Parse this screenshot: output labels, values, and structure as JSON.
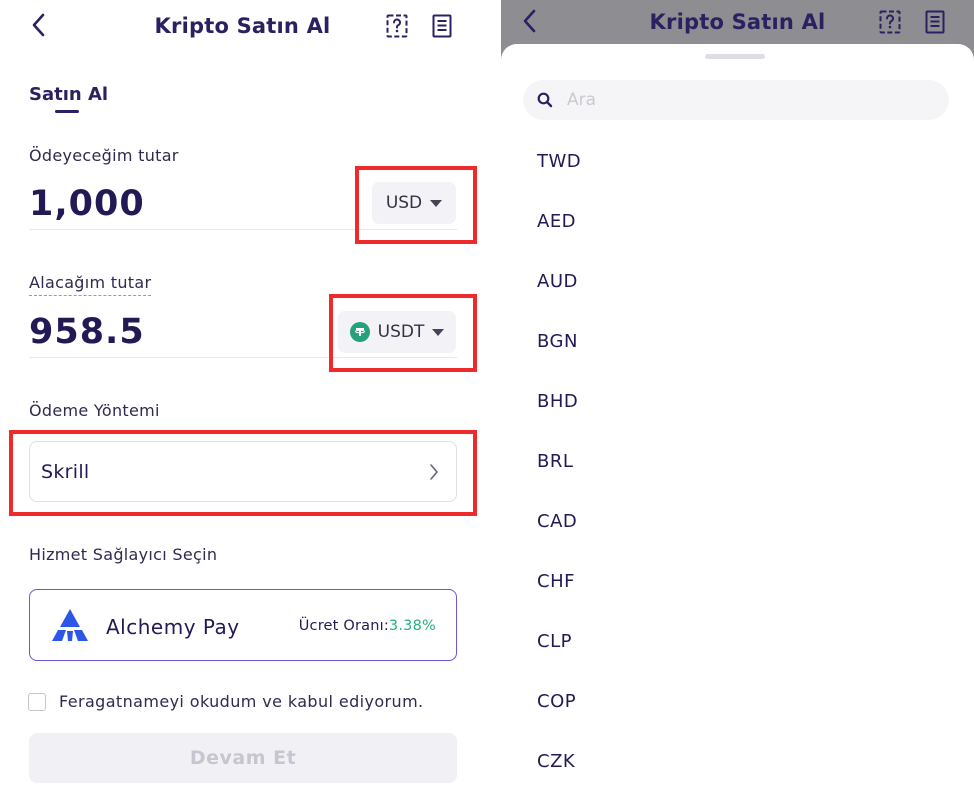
{
  "header": {
    "title": "Kripto Satın Al"
  },
  "tabs": {
    "buy": "Satın Al"
  },
  "pay": {
    "label": "Ödeyeceğim tutar",
    "amount": "1,000",
    "currency": "USD"
  },
  "receive": {
    "label": "Alacağım tutar",
    "amount": "958.5",
    "currency": "USDT"
  },
  "payment_method": {
    "label": "Ödeme Yöntemi",
    "value": "Skrill"
  },
  "provider": {
    "label": "Hizmet Sağlayıcı Seçin",
    "name": "Alchemy Pay",
    "fee_label": "Ücret Oranı:",
    "fee_rate": "3.38%"
  },
  "disclaimer": {
    "label": "Feragatnameyi okudum ve kabul ediyorum.",
    "checked": false
  },
  "continue_label": "Devam Et",
  "search": {
    "placeholder": "Ara"
  },
  "currencies": [
    "TWD",
    "AED",
    "AUD",
    "BGN",
    "BHD",
    "BRL",
    "CAD",
    "CHF",
    "CLP",
    "COP",
    "CZK"
  ],
  "colors": {
    "accent": "#2a2160",
    "highlight": "#ee2a2a",
    "provider_border": "#6c56d6",
    "fee_green": "#26b27a",
    "tether_green": "#26a17b"
  },
  "icons": {
    "back": "chevron-left-icon",
    "help": "question-doc-icon",
    "orders": "document-list-icon",
    "search": "search-icon"
  }
}
